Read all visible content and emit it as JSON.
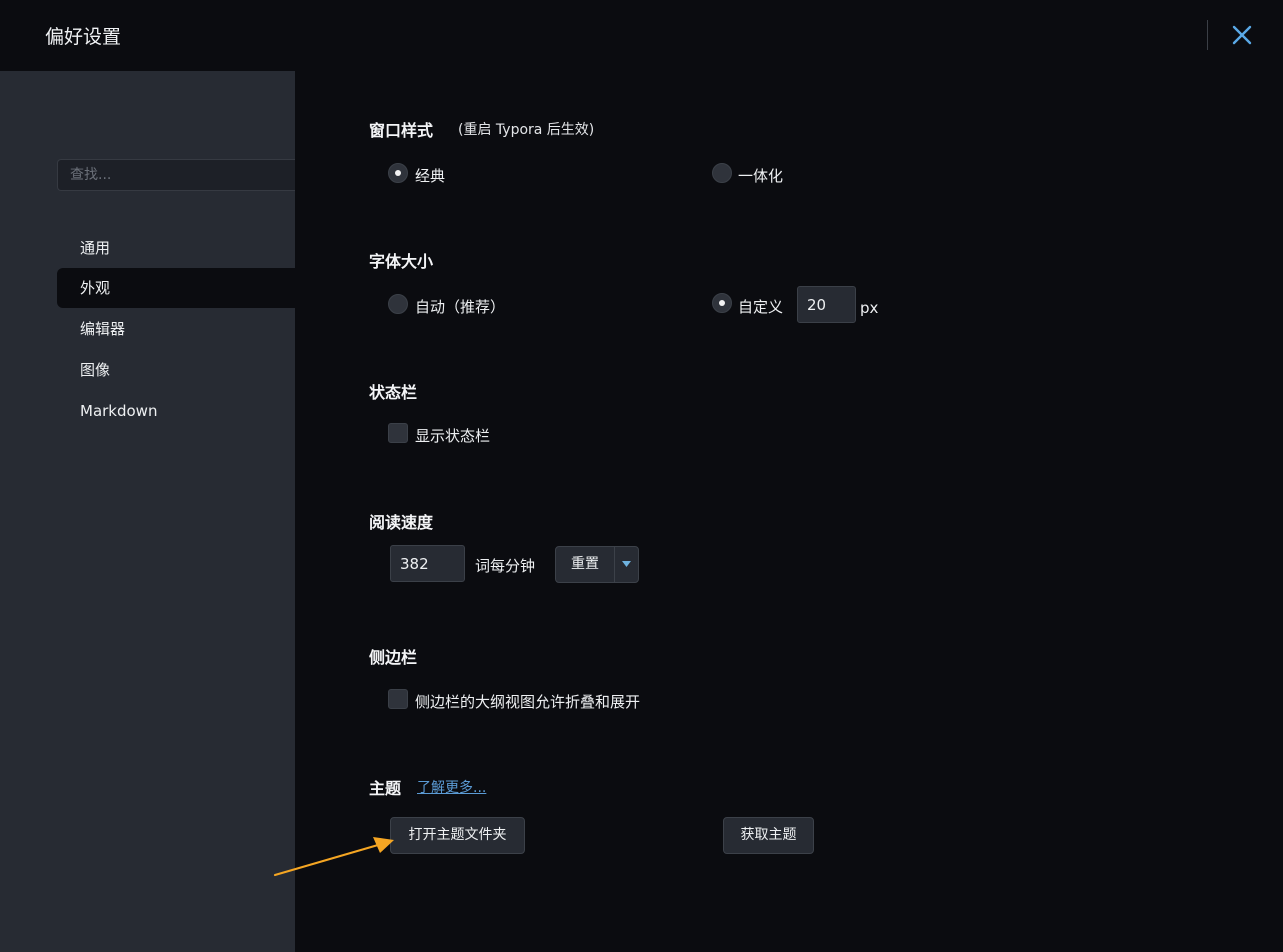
{
  "window": {
    "title": "偏好设置",
    "close_icon": "close-icon"
  },
  "sidebar": {
    "search_placeholder": "查找...",
    "items": [
      {
        "label": "通用",
        "active": false
      },
      {
        "label": "外观",
        "active": true
      },
      {
        "label": "编辑器",
        "active": false
      },
      {
        "label": "图像",
        "active": false
      },
      {
        "label": "Markdown",
        "active": false
      }
    ]
  },
  "window_style": {
    "title": "窗口样式",
    "note": "(重启 Typora 后生效)",
    "options": [
      {
        "label": "经典",
        "checked": true
      },
      {
        "label": "一体化",
        "checked": false
      }
    ]
  },
  "font_size": {
    "title": "字体大小",
    "auto_label": "自动（推荐）",
    "auto_checked": false,
    "custom_label": "自定义",
    "custom_checked": true,
    "custom_value": "20",
    "unit": "px"
  },
  "status_bar": {
    "title": "状态栏",
    "show_label": "显示状态栏",
    "checked": false
  },
  "reading_speed": {
    "title": "阅读速度",
    "value": "382",
    "unit_label": "词每分钟",
    "reset_label": "重置",
    "dropdown_icon": "triangle-down-icon"
  },
  "side_panel": {
    "title": "侧边栏",
    "outline_label": "侧边栏的大纲视图允许折叠和展开",
    "checked": false
  },
  "theme": {
    "title": "主题",
    "learn_more": "了解更多...",
    "open_folder_label": "打开主题文件夹",
    "get_themes_label": "获取主题"
  },
  "annotation": {
    "color": "#f5a623",
    "icon": "arrow-annotation-icon"
  }
}
